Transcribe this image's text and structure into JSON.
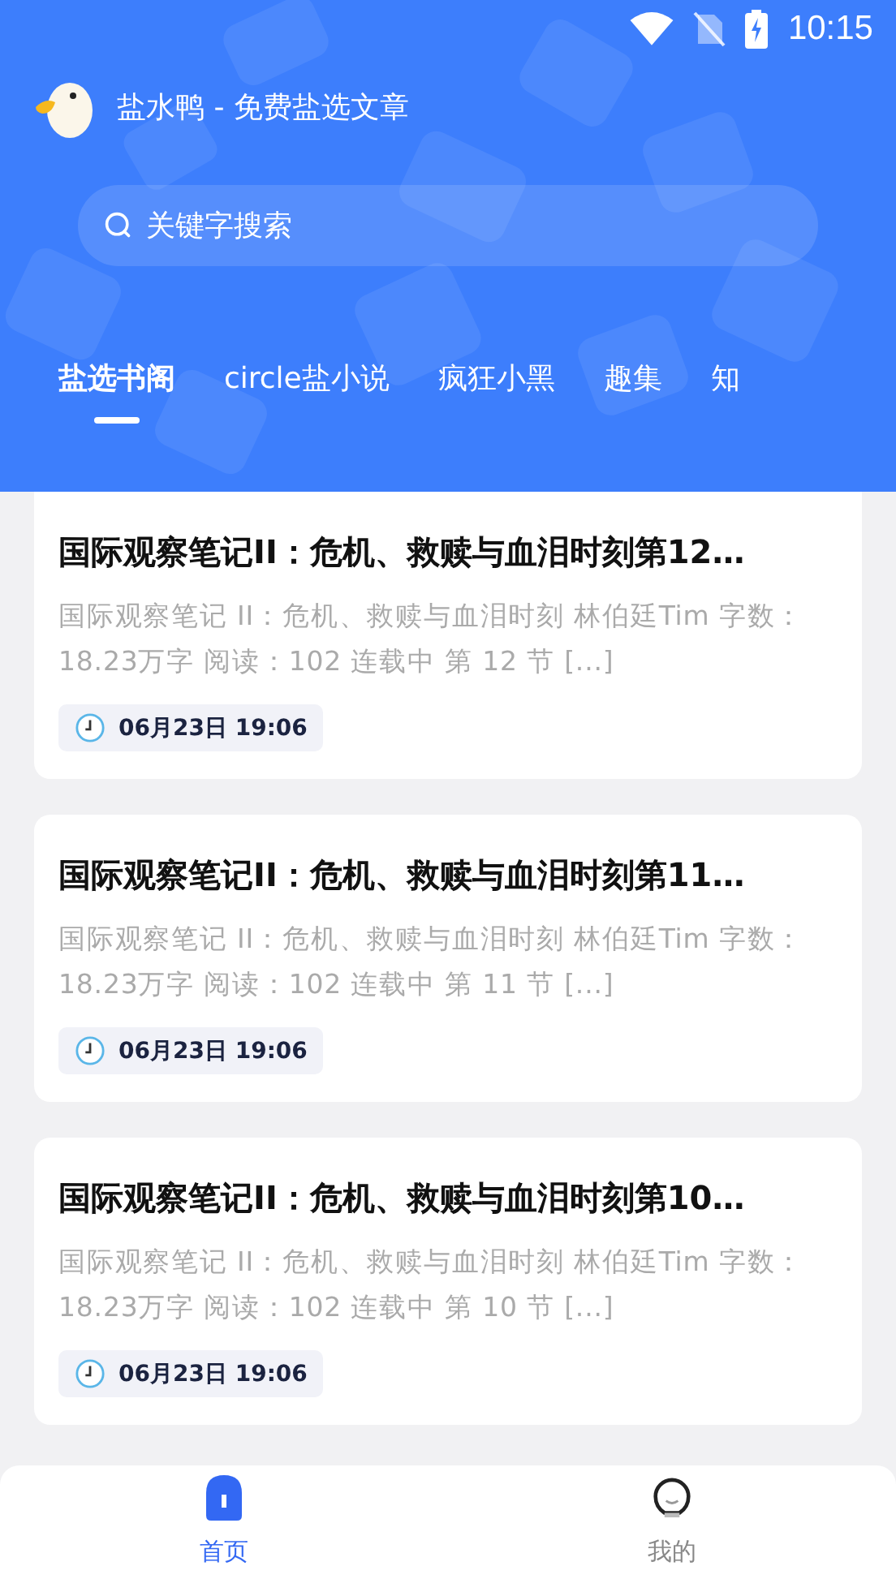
{
  "status_bar": {
    "time": "10:15"
  },
  "app_title": "盐水鸭 - 免费盐选文章",
  "search": {
    "placeholder": "关键字搜索"
  },
  "tabs": [
    {
      "label": "盐选书阁",
      "selected": true
    },
    {
      "label": "circle盐小说",
      "selected": false
    },
    {
      "label": "疯狂小黑",
      "selected": false
    },
    {
      "label": "趣集",
      "selected": false
    },
    {
      "label": "知",
      "selected": false
    }
  ],
  "articles": [
    {
      "title": "国际观察笔记II：危机、救赎与血泪时刻第12…",
      "summary": "国际观察笔记 II：危机、救赎与血泪时刻 林伯廷Tim 字数：18.23万字 阅读：102 连载中 第 12 节 [...]",
      "date": "06月23日 19:06"
    },
    {
      "title": "国际观察笔记II：危机、救赎与血泪时刻第11…",
      "summary": "国际观察笔记 II：危机、救赎与血泪时刻 林伯廷Tim 字数：18.23万字 阅读：102 连载中 第 11 节 [...]",
      "date": "06月23日 19:06"
    },
    {
      "title": "国际观察笔记II：危机、救赎与血泪时刻第10…",
      "summary": "国际观察笔记 II：危机、救赎与血泪时刻 林伯廷Tim 字数：18.23万字 阅读：102 连载中 第 10 节 [...]",
      "date": "06月23日 19:06"
    }
  ],
  "bottom_nav": [
    {
      "label": "首页",
      "kind": "home",
      "selected": true
    },
    {
      "label": "我的",
      "kind": "mine",
      "selected": false
    }
  ]
}
